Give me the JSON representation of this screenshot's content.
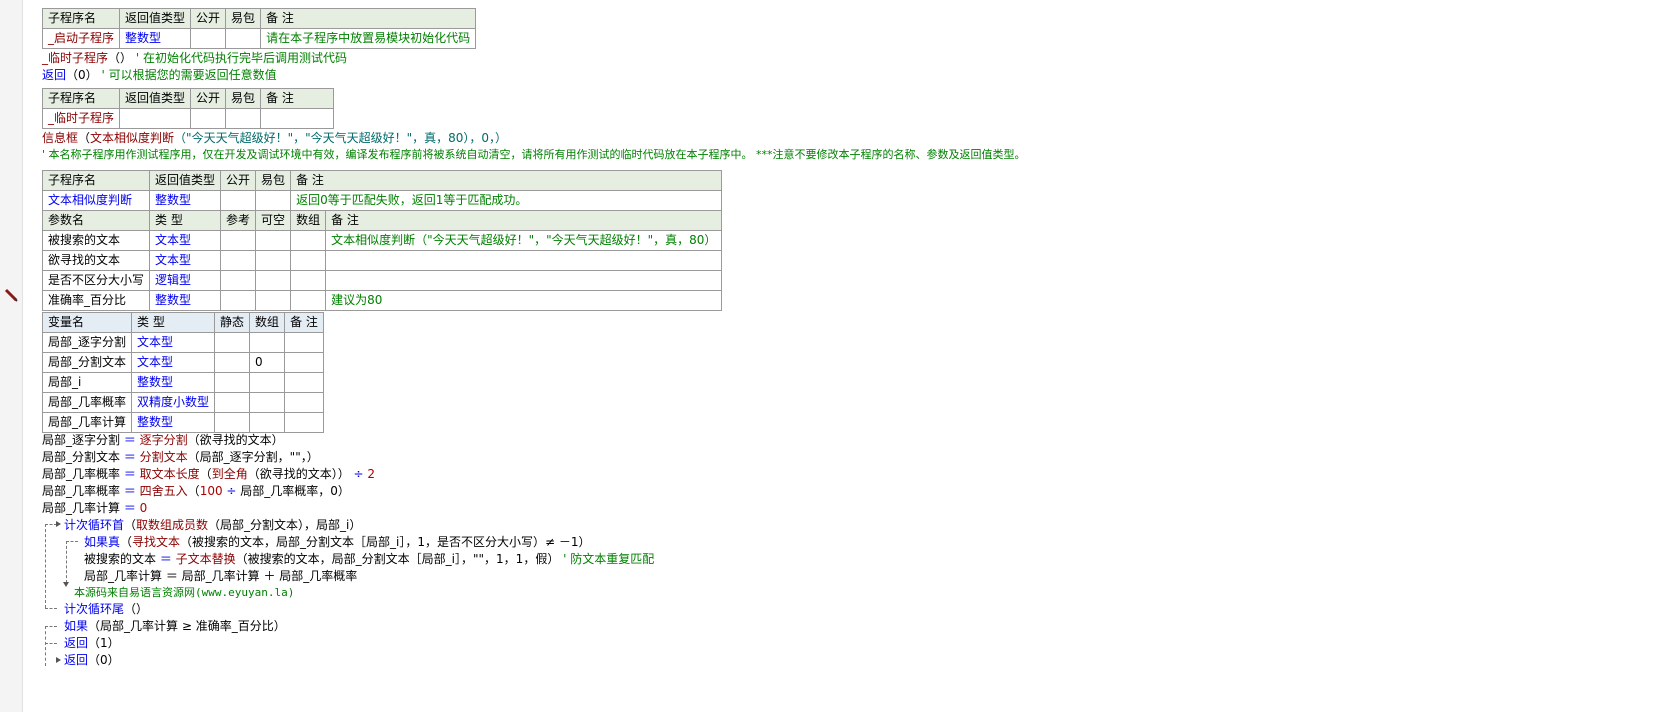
{
  "t1": {
    "headers": [
      "子程序名",
      "返回值类型",
      "公开",
      "易包",
      "备 注"
    ],
    "name": "_启动子程序",
    "type": "整数型",
    "note": "请在本子程序中放置易模块初始化代码"
  },
  "code1": {
    "call_fn": "_临时子程序",
    "call_paren": "（）",
    "call_comment": "' 在初始化代码执行完毕后调用测试代码",
    "ret_kw": "返回",
    "ret_arg": "（0）",
    "ret_comment": "' 可以根据您的需要返回任意数值"
  },
  "t2": {
    "headers": [
      "子程序名",
      "返回值类型",
      "公开",
      "易包",
      "备 注"
    ],
    "name": "_临时子程序"
  },
  "code2": {
    "msg_fn": "信息框",
    "msg_open": "（",
    "msg_inner_fn": "文本相似度判断",
    "msg_inner_args": "（\"今天天气超级好！\"，\"今天气天超级好！\"，真，80），0，）",
    "comment": "' 本名称子程序用作测试程序用，仅在开发及调试环境中有效，编译发布程序前将被系统自动清空，请将所有用作测试的临时代码放在本子程序中。 ***注意不要修改本子程序的名称、参数及返回值类型。"
  },
  "t3": {
    "headers": [
      "子程序名",
      "返回值类型",
      "公开",
      "易包",
      "备 注"
    ],
    "name": "文本相似度判断",
    "type": "整数型",
    "note": "返回0等于匹配失败，返回1等于匹配成功。",
    "param_headers": [
      "参数名",
      "类 型",
      "参考",
      "可空",
      "数组",
      "备 注"
    ],
    "params": [
      {
        "name": "被搜索的文本",
        "type": "文本型",
        "note": "文本相似度判断（\"今天天气超级好！\"，\"今天气天超级好！\"，真，80）"
      },
      {
        "name": "欲寻找的文本",
        "type": "文本型",
        "note": ""
      },
      {
        "name": "是否不区分大小写",
        "type": "逻辑型",
        "note": ""
      },
      {
        "name": "准确率_百分比",
        "type": "整数型",
        "note": "建议为80"
      }
    ]
  },
  "t4": {
    "headers": [
      "变量名",
      "类 型",
      "静态",
      "数组",
      "备 注"
    ],
    "vars": [
      {
        "name": "局部_逐字分割",
        "type": "文本型",
        "arr": ""
      },
      {
        "name": "局部_分割文本",
        "type": "文本型",
        "arr": "0"
      },
      {
        "name": "局部_i",
        "type": "整数型",
        "arr": ""
      },
      {
        "name": "局部_几率概率",
        "type": "双精度小数型",
        "arr": ""
      },
      {
        "name": "局部_几率计算",
        "type": "整数型",
        "arr": ""
      }
    ]
  },
  "code3": {
    "l1_var": "局部_逐字分割",
    "l1_eq": " ＝ ",
    "l1_fn": "逐字分割",
    "l1_args": "（欲寻找的文本）",
    "l2_var": "局部_分割文本",
    "l2_eq": " ＝ ",
    "l2_fn": "分割文本",
    "l2_args": "（局部_逐字分割，\"\"，）",
    "l3_var": "局部_几率概率",
    "l3_eq": " ＝ ",
    "l3_fn": "取文本长度",
    "l3_open": "（",
    "l3_fn2": "到全角",
    "l3_args": "（欲寻找的文本））",
    "l3_op": " ÷ ",
    "l3_num": "2",
    "l4_var": "局部_几率概率",
    "l4_eq": " ＝ ",
    "l4_fn": "四舍五入",
    "l4_open": "（",
    "l4_num": "100",
    "l4_op": " ÷ ",
    "l4_args": "局部_几率概率，0）",
    "l5_var": "局部_几率计算",
    "l5_eq": " ＝ ",
    "l5_num": "0",
    "loop_kw": "计次循环首",
    "loop_open": "（",
    "loop_fn": "取数组成员数",
    "loop_args": "（局部_分割文本），局部_i）",
    "if_kw": "如果真",
    "if_open": "（",
    "if_fn": "寻找文本",
    "if_args": "（被搜索的文本，局部_分割文本［局部_i］，1，是否不区分大小写）≠ －1）",
    "rep_var": "被搜索的文本",
    "rep_eq": " ＝ ",
    "rep_fn": "子文本替换",
    "rep_args": "（被搜索的文本，局部_分割文本［局部_i］，\"\"，1，1，假）",
    "rep_comment": " ' 防文本重复匹配",
    "acc_line": "局部_几率计算 ＝ 局部_几率计算 ＋ 局部_几率概率",
    "source_note": "本源码来自易语言资源网(www.eyuyan.la)",
    "loop_end": "计次循环尾",
    "loop_end_args": "（）",
    "if2_kw": "如果",
    "if2_args": "（局部_几率计算 ≥ 准确率_百分比）",
    "ret1_kw": "返回",
    "ret1_args": "（1）",
    "ret0_kw": "返回",
    "ret0_args": "（0）"
  }
}
